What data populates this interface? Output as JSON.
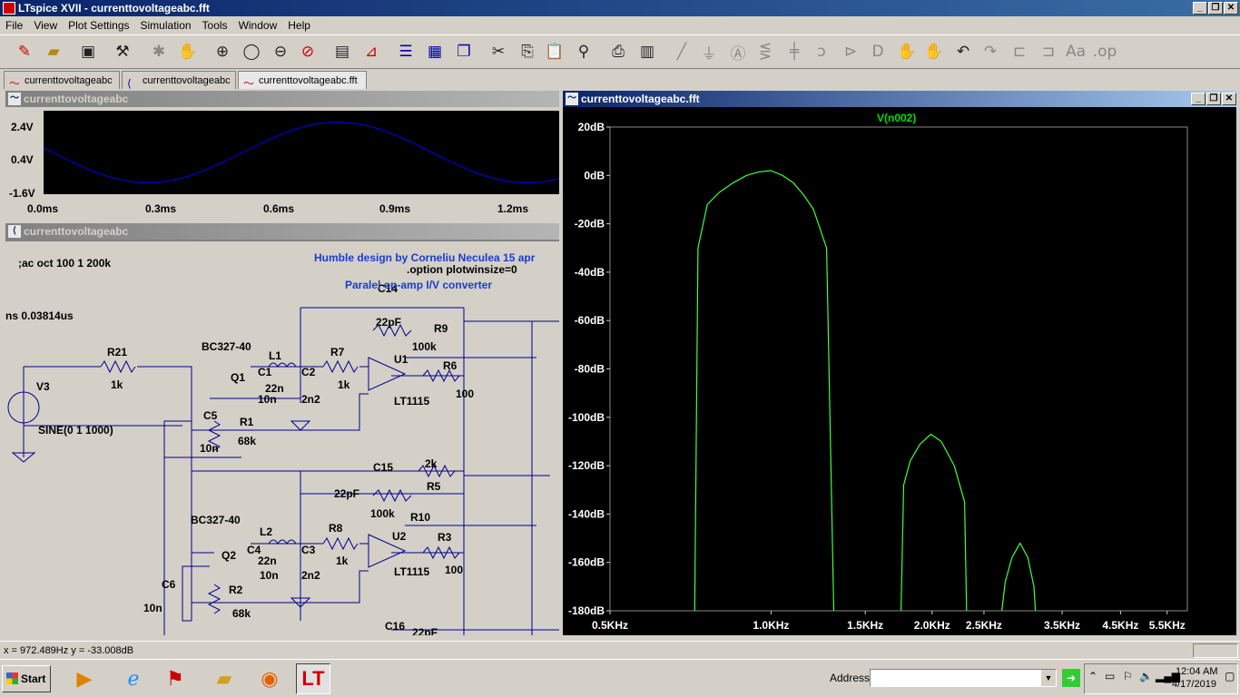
{
  "app": {
    "title": "LTspice XVII - currenttovoltageabc.fft"
  },
  "menu": [
    "File",
    "View",
    "Plot Settings",
    "Simulation",
    "Tools",
    "Window",
    "Help"
  ],
  "tabs": [
    {
      "label": "currenttovoltageabc",
      "icon": "waveform-icon"
    },
    {
      "label": "currenttovoltageabc",
      "icon": "schematic-icon"
    },
    {
      "label": "currenttovoltageabc.fft",
      "icon": "waveform-icon"
    }
  ],
  "time_plot": {
    "caption": "currenttovoltageabc",
    "y_ticks": [
      "2.4V",
      "0.4V",
      "-1.6V"
    ],
    "x_ticks": [
      "0.0ms",
      "0.3ms",
      "0.6ms",
      "0.9ms",
      "1.2ms"
    ],
    "trace_color": "#0000c0"
  },
  "schematic": {
    "caption": "currenttovoltageabc",
    "directives": [
      ";ac oct 100 1 200k",
      ".option plotwinsize=0"
    ],
    "header": [
      "Humble design by Corneliu Neculea 15 apr",
      "Paralel op-amp I/V converter"
    ],
    "truncated_text": "ns 0.03814us",
    "labels": [
      "C14",
      "22pF",
      "R9",
      "100k",
      "R21",
      "1k",
      "BC327-40",
      "L1",
      "R7",
      "1k",
      "U1",
      "R6",
      "100",
      "Q1",
      "C1",
      "C2",
      "22n",
      "2n2",
      "10n",
      "LT1115",
      "V3",
      "C5",
      "R1",
      "SINE(0 1 1000)",
      "10n",
      "68k",
      "C15",
      "2k",
      "22pF",
      "R5",
      "100k",
      "R10",
      "BC327-40",
      "L2",
      "R8",
      "1k",
      "U2",
      "R3",
      "100",
      "Q2",
      "C4",
      "C3",
      "22n",
      "2n2",
      "10n",
      "LT1115",
      "C6",
      "10n",
      "R2",
      "68k",
      "C16",
      "22pF"
    ]
  },
  "fft_plot": {
    "caption": "currenttovoltageabc.fft",
    "trace_label": "V(n002)",
    "trace_color": "#40ff40",
    "label_color": "#00e000",
    "y_ticks": [
      "20dB",
      "0dB",
      "-20dB",
      "-40dB",
      "-60dB",
      "-80dB",
      "-100dB",
      "-120dB",
      "-140dB",
      "-160dB",
      "-180dB"
    ],
    "x_ticks": [
      "0.5KHz",
      "1.0KHz",
      "1.5KHz",
      "2.0KHz",
      "2.5KHz",
      "3.5KHz",
      "4.5KHz",
      "5.5KHz"
    ]
  },
  "chart_data": {
    "type": "line",
    "title": "V(n002)",
    "xscale": "log",
    "xlim": [
      500,
      6000
    ],
    "ylim": [
      -180,
      20
    ],
    "xlabel": "",
    "ylabel": "",
    "grid": false,
    "series": [
      {
        "name": "V(n002)",
        "x_hz": [
          720,
          730,
          760,
          800,
          850,
          900,
          950,
          1000,
          1050,
          1100,
          1150,
          1200,
          1270,
          1310
        ],
        "y_db": [
          -180,
          -30,
          -12,
          -7,
          -3,
          0,
          1.5,
          2,
          0,
          -3,
          -8,
          -14,
          -30,
          -180
        ]
      },
      {
        "name": "V(n002)",
        "x_hz": [
          1750,
          1770,
          1820,
          1900,
          1990,
          2080,
          2200,
          2300,
          2320
        ],
        "y_db": [
          -180,
          -128,
          -118,
          -111,
          -107,
          -110,
          -120,
          -135,
          -180
        ]
      },
      {
        "name": "V(n002)",
        "x_hz": [
          2700,
          2740,
          2820,
          2920,
          3020,
          3100,
          3120
        ],
        "y_db": [
          -180,
          -168,
          -158,
          -152,
          -158,
          -170,
          -180
        ]
      }
    ]
  },
  "status": {
    "coords": "x = 972.489Hz   y = -33.008dB"
  },
  "taskbar": {
    "start_label": "Start",
    "address_label": "Address",
    "address_value": "",
    "time": "12:04 AM",
    "date": "4/17/2019"
  },
  "window_controls": {
    "minimize": "_",
    "restore": "❐",
    "close": "✕"
  }
}
